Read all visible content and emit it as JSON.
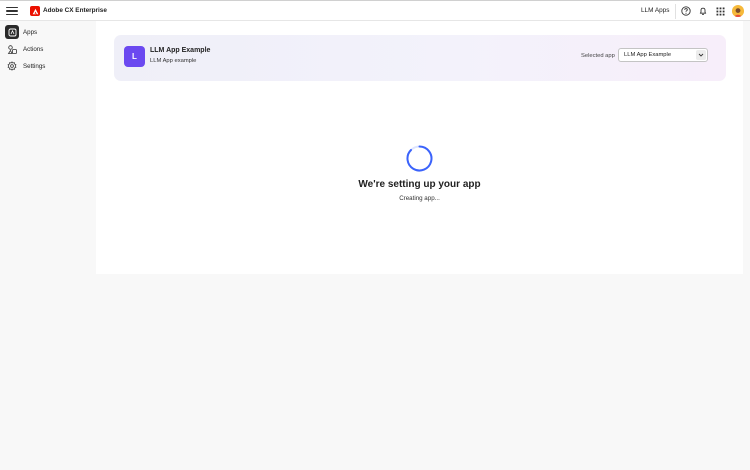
{
  "topbar": {
    "brand": "Adobe CX Enterprise",
    "context_label": "LLM Apps",
    "icons": [
      "menu-icon",
      "adobe-logo",
      "help-icon",
      "bell-icon",
      "app-grid-icon",
      "avatar"
    ]
  },
  "sidebar": {
    "items": [
      {
        "label": "Apps",
        "icon": "apps-icon",
        "active": true
      },
      {
        "label": "Actions",
        "icon": "actions-icon",
        "active": false
      },
      {
        "label": "Settings",
        "icon": "gear-icon",
        "active": false
      }
    ]
  },
  "app_header": {
    "tile_letter": "L",
    "name": "LLM App Example",
    "subtitle": "LLM App example",
    "selected_label": "Selected app",
    "selected_value": "LLM App Example"
  },
  "loading": {
    "title": "We're setting up your app",
    "subtitle": "Creating app..."
  },
  "colors": {
    "brand_red": "#eb1000",
    "accent_purple": "#6b49f0",
    "spinner_blue": "#3b63fb"
  }
}
